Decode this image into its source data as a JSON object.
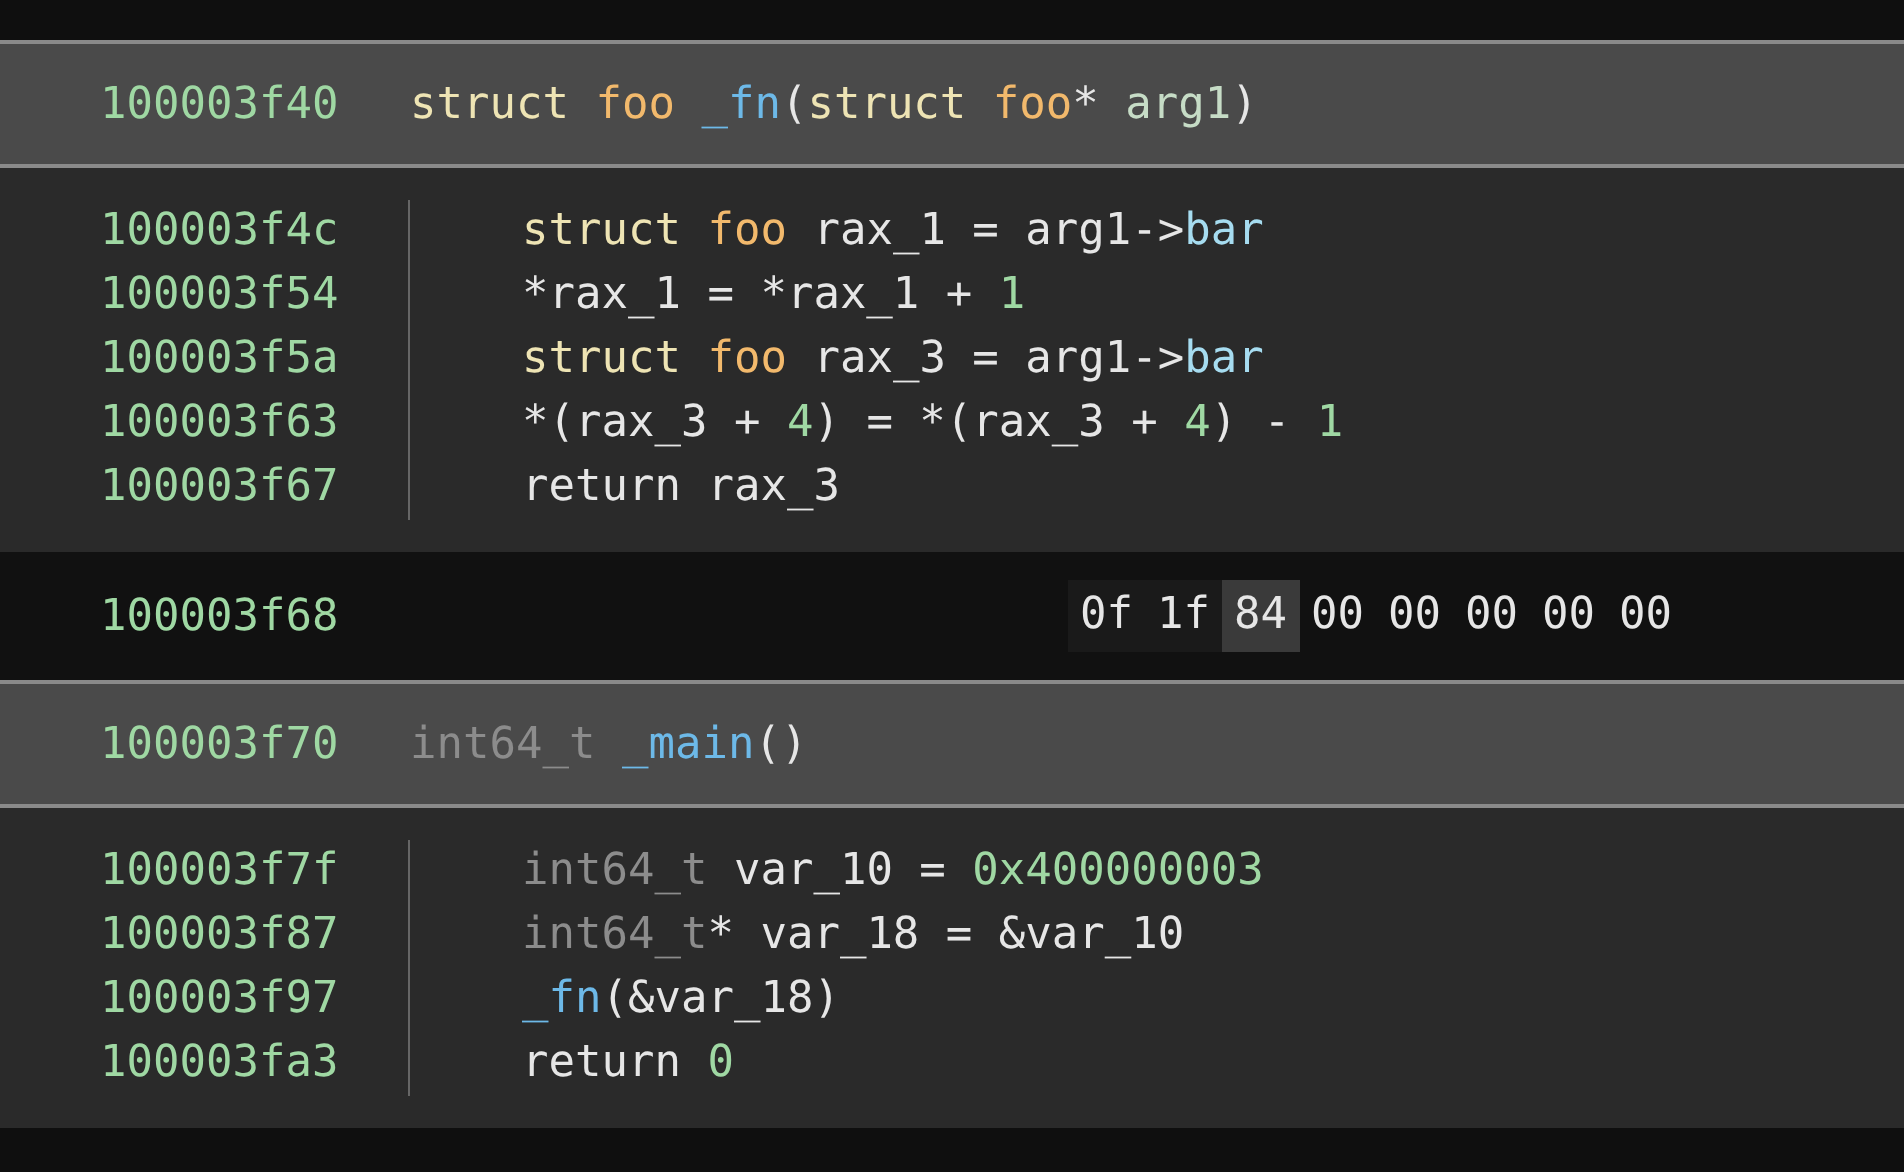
{
  "blocks": [
    {
      "kind": "header",
      "address": "100003f40",
      "tokens": [
        {
          "text": "struct ",
          "kind": "keyword"
        },
        {
          "text": "foo ",
          "kind": "type"
        },
        {
          "text": "_fn",
          "kind": "function"
        },
        {
          "text": "(",
          "kind": "plain"
        },
        {
          "text": "struct ",
          "kind": "keyword"
        },
        {
          "text": "foo",
          "kind": "type"
        },
        {
          "text": "* ",
          "kind": "plain"
        },
        {
          "text": "arg1",
          "kind": "variable"
        },
        {
          "text": ")",
          "kind": "plain"
        }
      ]
    },
    {
      "kind": "body",
      "lines": [
        {
          "address": "100003f4c",
          "tokens": [
            {
              "text": "struct ",
              "kind": "keyword"
            },
            {
              "text": "foo",
              "kind": "type"
            },
            {
              "text": " rax_1 = arg1->",
              "kind": "plain"
            },
            {
              "text": "bar",
              "kind": "field"
            }
          ]
        },
        {
          "address": "100003f54",
          "tokens": [
            {
              "text": "*rax_1 = *rax_1 + ",
              "kind": "plain"
            },
            {
              "text": "1",
              "kind": "number"
            }
          ]
        },
        {
          "address": "100003f5a",
          "tokens": [
            {
              "text": "struct ",
              "kind": "keyword"
            },
            {
              "text": "foo",
              "kind": "type"
            },
            {
              "text": " rax_3 = arg1->",
              "kind": "plain"
            },
            {
              "text": "bar",
              "kind": "field"
            }
          ]
        },
        {
          "address": "100003f63",
          "tokens": [
            {
              "text": "*(rax_3 + ",
              "kind": "plain"
            },
            {
              "text": "4",
              "kind": "number"
            },
            {
              "text": ") = *(rax_3 + ",
              "kind": "plain"
            },
            {
              "text": "4",
              "kind": "number"
            },
            {
              "text": ") - ",
              "kind": "plain"
            },
            {
              "text": "1",
              "kind": "number"
            }
          ]
        },
        {
          "address": "100003f67",
          "tokens": [
            {
              "text": "return rax_3",
              "kind": "plain"
            }
          ]
        }
      ]
    },
    {
      "kind": "data",
      "address": "100003f68",
      "bytes": [
        {
          "text": "0f",
          "kind": "instruction",
          "selected": false
        },
        {
          "text": "1f",
          "kind": "instruction",
          "selected": false
        },
        {
          "text": "84",
          "kind": "instruction",
          "selected": true
        },
        {
          "text": "00",
          "kind": "padding",
          "selected": false
        },
        {
          "text": "00",
          "kind": "padding",
          "selected": false
        },
        {
          "text": "00",
          "kind": "padding",
          "selected": false
        },
        {
          "text": "00",
          "kind": "padding",
          "selected": false
        },
        {
          "text": "00",
          "kind": "padding",
          "selected": false
        }
      ]
    },
    {
      "kind": "header",
      "address": "100003f70",
      "tokens": [
        {
          "text": "int64_t ",
          "kind": "builtin"
        },
        {
          "text": "_main",
          "kind": "function"
        },
        {
          "text": "()",
          "kind": "plain"
        }
      ]
    },
    {
      "kind": "body",
      "lines": [
        {
          "address": "100003f7f",
          "tokens": [
            {
              "text": "int64_t",
              "kind": "builtin"
            },
            {
              "text": " var_10 = ",
              "kind": "plain"
            },
            {
              "text": "0x400000003",
              "kind": "number"
            }
          ]
        },
        {
          "address": "100003f87",
          "tokens": [
            {
              "text": "int64_t",
              "kind": "builtin"
            },
            {
              "text": "* var_18 = &var_10",
              "kind": "plain"
            }
          ]
        },
        {
          "address": "100003f97",
          "tokens": [
            {
              "text": "_fn",
              "kind": "function"
            },
            {
              "text": "(&var_18)",
              "kind": "plain"
            }
          ]
        },
        {
          "address": "100003fa3",
          "tokens": [
            {
              "text": "return ",
              "kind": "plain"
            },
            {
              "text": "0",
              "kind": "number"
            }
          ]
        }
      ]
    }
  ]
}
